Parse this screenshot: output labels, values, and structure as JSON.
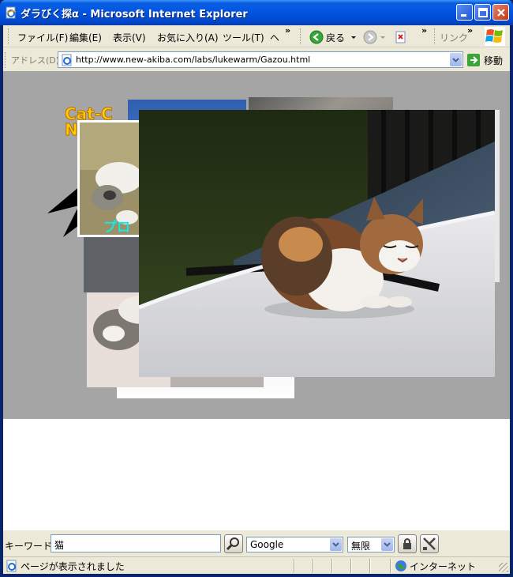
{
  "window": {
    "title": "ダラびく探α - Microsoft Internet Explorer"
  },
  "menu": {
    "items": [
      {
        "label": "ファイル(F)"
      },
      {
        "label": "編集(E)"
      },
      {
        "label": "表示(V)"
      },
      {
        "label": "お気に入り(A)"
      },
      {
        "label": "ツール(T)"
      },
      {
        "label": "ヘ"
      }
    ],
    "overflow": "»"
  },
  "toolbar": {
    "back_label": "戻る",
    "links_label": "リンク",
    "overflow": "»"
  },
  "address": {
    "label": "アドレス(D)",
    "url": "http://www.new-akiba.com/labs/lukewarm/Gazou.html",
    "go_label": "移動"
  },
  "page": {
    "logo_text": "Cat‑C",
    "logo_sub": "N",
    "overlay_text": "プロ"
  },
  "keyword_bar": {
    "label": "キーワード:",
    "query": "猫",
    "engine": "Google",
    "limit": "無限"
  },
  "status": {
    "text": "ページが表示されました",
    "zone": "インターネット"
  },
  "colors": {
    "stage_bg": "#a5a5a5",
    "title_blue": "#0054e3"
  }
}
